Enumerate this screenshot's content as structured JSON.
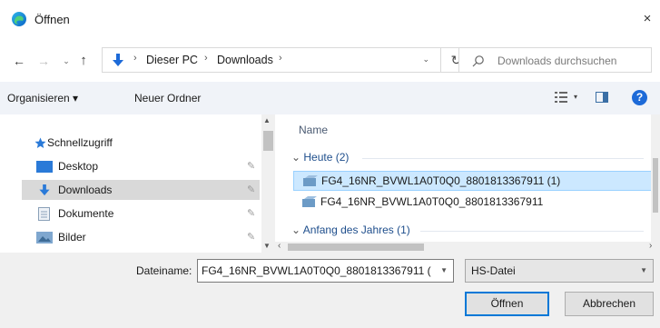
{
  "window": {
    "title": "Öffnen",
    "close": "×"
  },
  "nav": {
    "back": "←",
    "forward": "→",
    "recent": "⌄",
    "up": "↑",
    "breadcrumb": [
      "Dieser PC",
      "Downloads"
    ],
    "separator": "›",
    "dropdown": "⌄",
    "refresh": "↻",
    "search_placeholder": "Downloads durchsuchen"
  },
  "toolbar": {
    "organize": "Organisieren ▾",
    "new_folder": "Neuer Ordner",
    "view_dropdown": "▾",
    "help": "?"
  },
  "sidebar": {
    "quick_access": "Schnellzugriff",
    "items": [
      {
        "label": "Desktop",
        "icon": "desktop-icon",
        "pinned": true
      },
      {
        "label": "Downloads",
        "icon": "downloads-icon",
        "pinned": true,
        "selected": true
      },
      {
        "label": "Dokumente",
        "icon": "documents-icon",
        "pinned": true
      },
      {
        "label": "Bilder",
        "icon": "pictures-icon",
        "pinned": true
      }
    ],
    "pin": "✎"
  },
  "files": {
    "column_name": "Name",
    "groups": [
      {
        "label": "Heute (2)",
        "items": [
          {
            "name": "FG4_16NR_BVWL1A0T0Q0_8801813367911 (1)",
            "selected": true
          },
          {
            "name": "FG4_16NR_BVWL1A0T0Q0_8801813367911",
            "selected": false
          }
        ]
      },
      {
        "label": "Anfang des Jahres (1)",
        "items": []
      }
    ]
  },
  "footer": {
    "filename_label": "Dateiname:",
    "filename_value": "FG4_16NR_BVWL1A0T0Q0_8801813367911 (",
    "filetype_value": "HS-Datei",
    "open_button": "Öffnen",
    "cancel_button": "Abbrechen"
  },
  "colors": {
    "accent": "#0078d7",
    "selection": "#cce8ff",
    "toolbar_bg": "#f0f3f8",
    "group_header": "#1e4e8c"
  }
}
